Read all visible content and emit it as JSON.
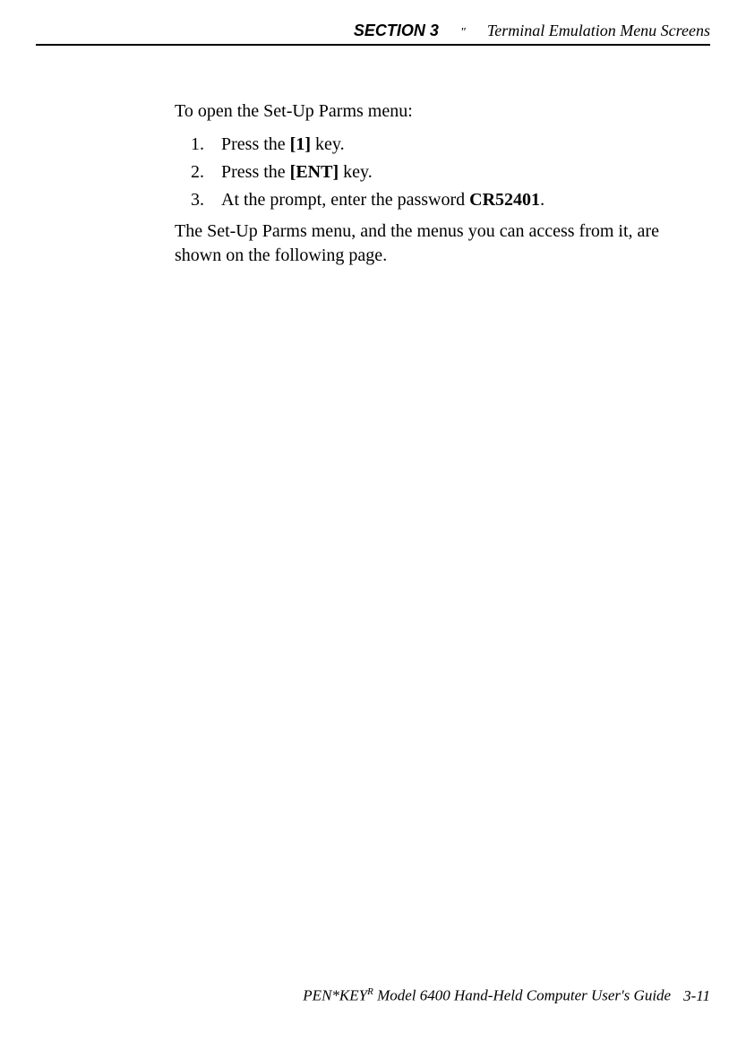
{
  "header": {
    "section": "SECTION 3",
    "separator": "\"",
    "title": "Terminal Emulation Menu Screens"
  },
  "body": {
    "intro": "To open the Set-Up Parms menu:",
    "steps": [
      {
        "num": "1.",
        "prefix": "Press the ",
        "bold": "[1]",
        "suffix": " key."
      },
      {
        "num": "2.",
        "prefix": "Press the ",
        "bold": "[ENT]",
        "suffix": " key."
      },
      {
        "num": "3.",
        "prefix": "At the prompt, enter the password ",
        "bold": "CR52401",
        "suffix": "."
      }
    ],
    "outro": "The Set-Up Parms menu, and the menus you can access from it, are shown on the following page."
  },
  "footer": {
    "brand": "PEN*KEY",
    "sup": "R",
    "rest": " Model 6400 Hand-Held Computer User's Guide",
    "page": "3-11"
  }
}
